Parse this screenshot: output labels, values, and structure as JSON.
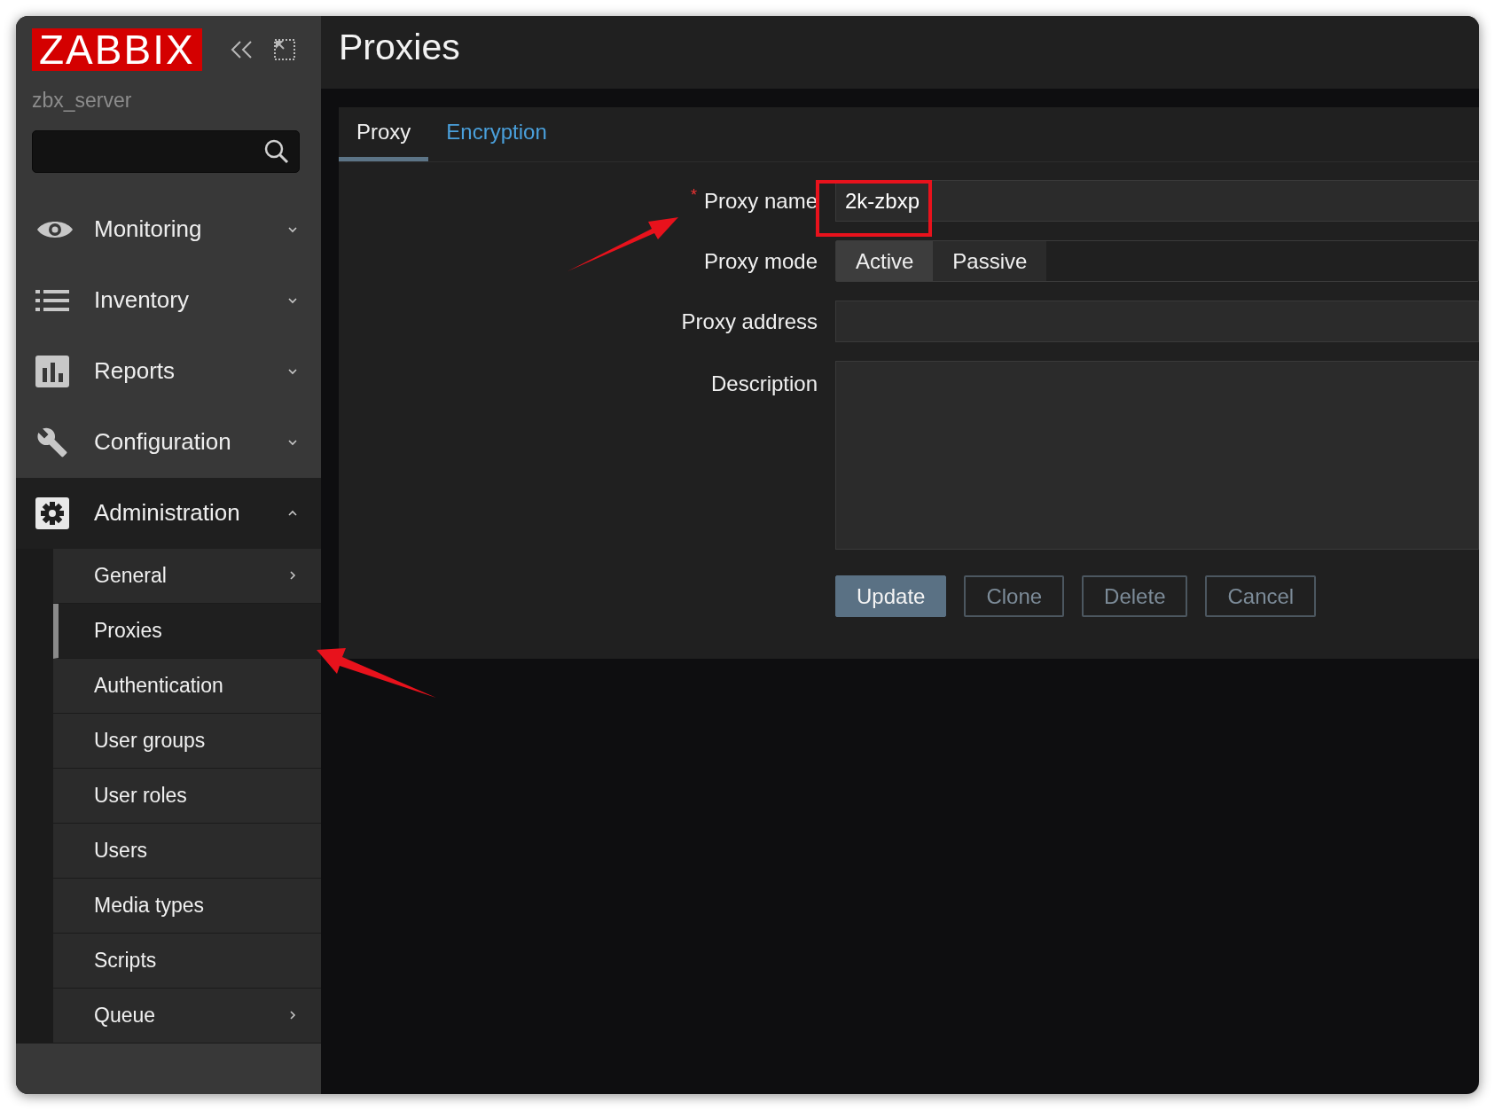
{
  "sidebar": {
    "logo": "ZABBIX",
    "server_name": "zbx_server",
    "menu": [
      {
        "label": "Monitoring",
        "kind": "eye",
        "expanded": false
      },
      {
        "label": "Inventory",
        "kind": "list",
        "expanded": false
      },
      {
        "label": "Reports",
        "kind": "chart",
        "expanded": false
      },
      {
        "label": "Configuration",
        "kind": "wrench",
        "expanded": false
      },
      {
        "label": "Administration",
        "kind": "gear",
        "expanded": true,
        "children": [
          {
            "label": "General",
            "selected": false,
            "has_submenu": true
          },
          {
            "label": "Proxies",
            "selected": true,
            "has_submenu": false
          },
          {
            "label": "Authentication",
            "selected": false,
            "has_submenu": false
          },
          {
            "label": "User groups",
            "selected": false,
            "has_submenu": false
          },
          {
            "label": "User roles",
            "selected": false,
            "has_submenu": false
          },
          {
            "label": "Users",
            "selected": false,
            "has_submenu": false
          },
          {
            "label": "Media types",
            "selected": false,
            "has_submenu": false
          },
          {
            "label": "Scripts",
            "selected": false,
            "has_submenu": false
          },
          {
            "label": "Queue",
            "selected": false,
            "has_submenu": true
          }
        ]
      }
    ]
  },
  "page_title": "Proxies",
  "tabs": [
    {
      "label": "Proxy",
      "selected": true
    },
    {
      "label": "Encryption",
      "selected": false
    }
  ],
  "form": {
    "proxy_name": {
      "label": "Proxy name",
      "required_mark": "*",
      "value": "2k-zbxp"
    },
    "proxy_mode": {
      "label": "Proxy mode",
      "options": [
        {
          "label": "Active",
          "selected": true
        },
        {
          "label": "Passive",
          "selected": false
        }
      ]
    },
    "proxy_address": {
      "label": "Proxy address"
    },
    "description": {
      "label": "Description"
    },
    "buttons": [
      {
        "label": "Update",
        "kind": "primary"
      },
      {
        "label": "Clone",
        "kind": "outline"
      },
      {
        "label": "Delete",
        "kind": "outline"
      },
      {
        "label": "Cancel",
        "kind": "outline"
      }
    ]
  }
}
